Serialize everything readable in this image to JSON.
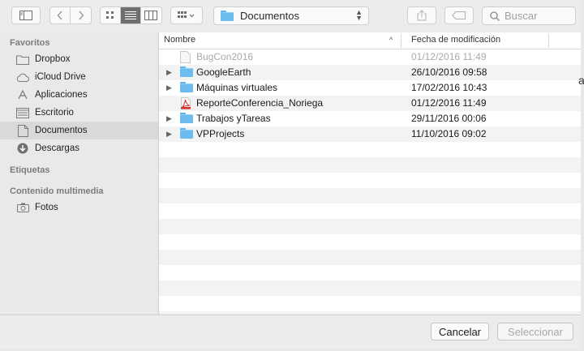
{
  "toolbar": {
    "path_label": "Documentos",
    "search_placeholder": "Buscar"
  },
  "sidebar": {
    "sections": [
      {
        "title": "Favoritos",
        "items": [
          {
            "label": "Dropbox",
            "icon": "folder-icon"
          },
          {
            "label": "iCloud Drive",
            "icon": "cloud-icon"
          },
          {
            "label": "Aplicaciones",
            "icon": "apps-icon"
          },
          {
            "label": "Escritorio",
            "icon": "desktop-icon"
          },
          {
            "label": "Documentos",
            "icon": "document-icon",
            "selected": true
          },
          {
            "label": "Descargas",
            "icon": "download-icon"
          }
        ]
      },
      {
        "title": "Etiquetas",
        "items": []
      },
      {
        "title": "Contenido multimedia",
        "items": [
          {
            "label": "Fotos",
            "icon": "camera-icon"
          }
        ]
      }
    ]
  },
  "list": {
    "columns": {
      "name": "Nombre",
      "date": "Fecha de modificación"
    },
    "rows": [
      {
        "name": "BugCon2016",
        "date": "01/12/2016 11:49",
        "kind": "file",
        "disabled": true,
        "expandable": false
      },
      {
        "name": "GoogleEarth",
        "date": "26/10/2016 09:58",
        "kind": "folder",
        "disabled": false,
        "expandable": true
      },
      {
        "name": "Máquinas virtuales",
        "date": "17/02/2016 10:43",
        "kind": "folder",
        "disabled": false,
        "expandable": true
      },
      {
        "name": "ReporteConferencia_Noriega",
        "date": "01/12/2016 11:49",
        "kind": "pdf",
        "disabled": false,
        "expandable": false
      },
      {
        "name": "Trabajos yTareas",
        "date": "29/11/2016 00:06",
        "kind": "folder",
        "disabled": false,
        "expandable": true
      },
      {
        "name": "VPProjects",
        "date": "11/10/2016 09:02",
        "kind": "folder",
        "disabled": false,
        "expandable": true
      }
    ]
  },
  "buttons": {
    "cancel": "Cancelar",
    "select": "Seleccionar"
  },
  "edge_text": "a"
}
